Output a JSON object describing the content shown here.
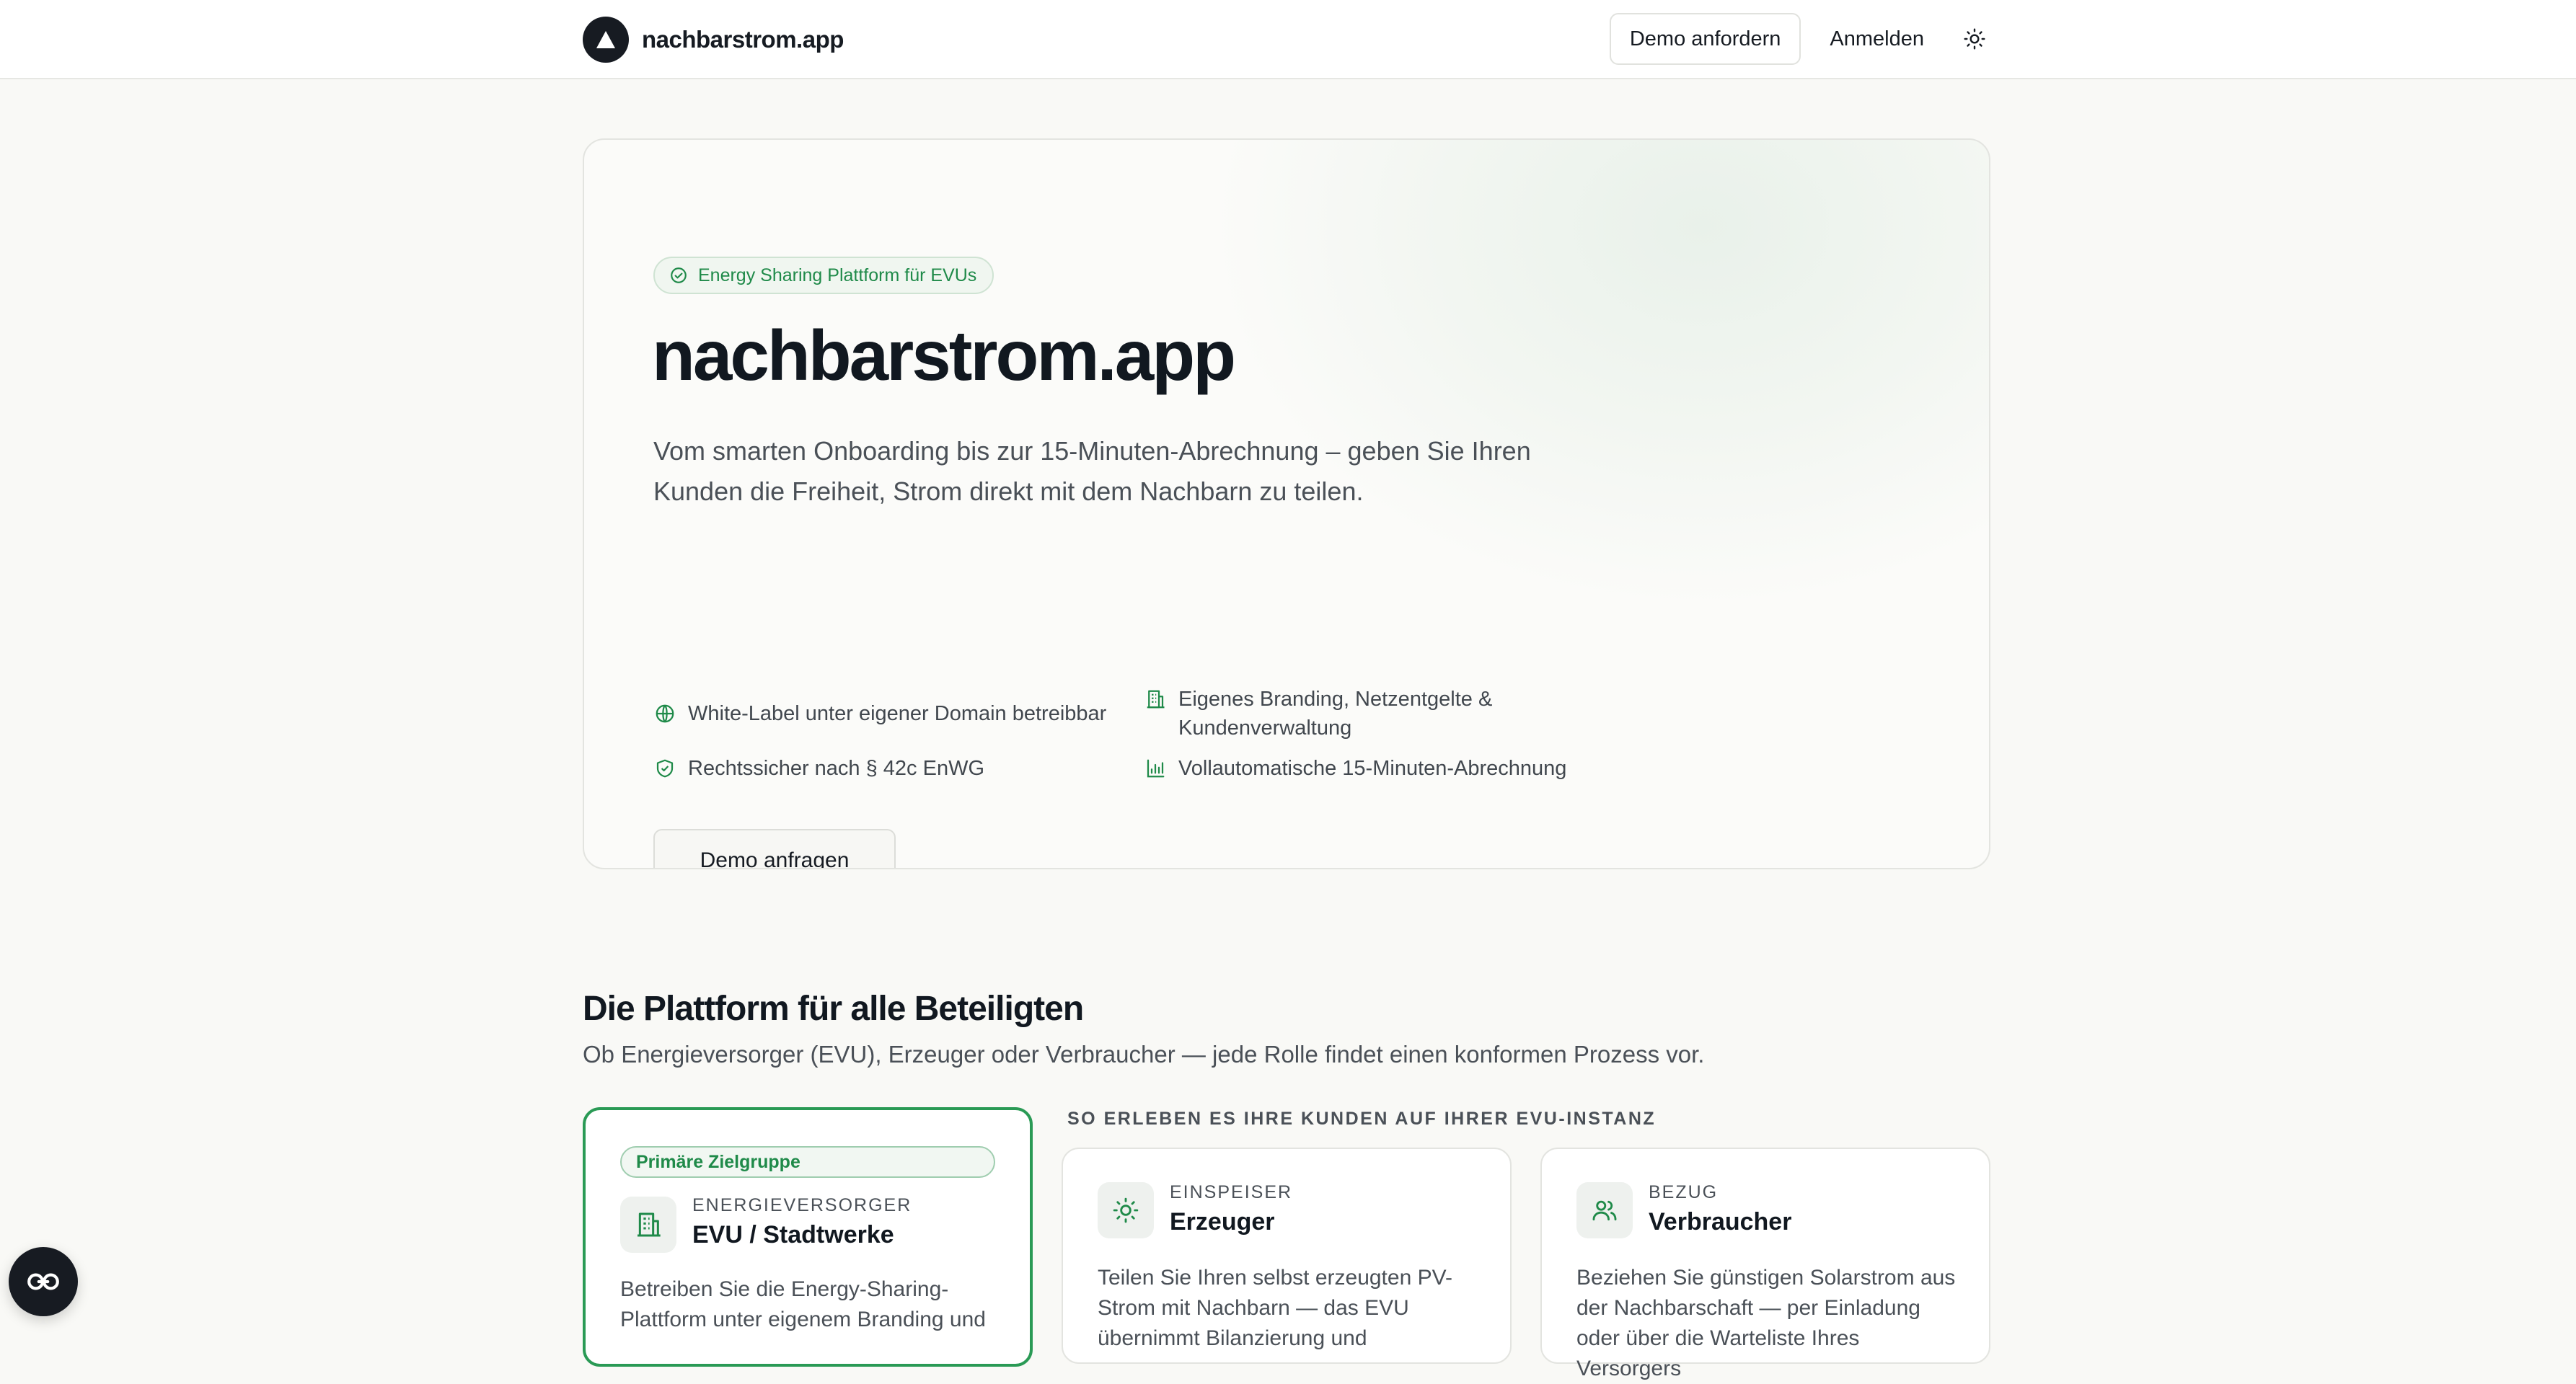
{
  "header": {
    "brand_name": "nachbarstrom.app",
    "demo_button": "Demo anfordern",
    "login_link": "Anmelden",
    "logo_icon": "triangle-logo-icon",
    "theme_icon": "sun-icon"
  },
  "hero": {
    "badge": "Energy Sharing Plattform für EVUs",
    "title": "nachbarstrom.app",
    "subtitle": "Vom smarten Onboarding bis zur 15-Minuten-Abrechnung – geben Sie Ihren Kunden die Freiheit, Strom direkt mit dem Nachbarn zu teilen.",
    "features": [
      {
        "icon": "globe-icon",
        "text": "White-Label unter eigener Domain betreibbar"
      },
      {
        "icon": "building-icon",
        "text": "Eigenes Branding, Netzentgelte & Kundenverwaltung"
      },
      {
        "icon": "shield-check-icon",
        "text": "Rechtssicher nach § 42c EnWG"
      },
      {
        "icon": "bar-chart-icon",
        "text": "Vollautomatische 15-Minuten-Abrechnung"
      }
    ],
    "cta": "Demo anfragen"
  },
  "section": {
    "title": "Die Plattform für alle Beteiligten",
    "subtitle": "Ob Energieversorger (EVU), Erzeuger oder Verbraucher — jede Rolle findet einen konformen Prozess vor.",
    "caption": "SO ERLEBEN ES IHRE KUNDEN AUF IHRER EVU-INSTANZ",
    "cards": [
      {
        "pill": "Primäre Zielgruppe",
        "eyebrow": "ENERGIEVERSORGER",
        "name": "EVU / Stadtwerke",
        "desc": "Betreiben Sie die Energy-Sharing-Plattform unter eigenem Branding und",
        "icon": "building-icon"
      },
      {
        "eyebrow": "EINSPEISER",
        "name": "Erzeuger",
        "desc": "Teilen Sie Ihren selbst erzeugten PV-Strom mit Nachbarn — das EVU übernimmt Bilanzierung und",
        "icon": "sun-icon"
      },
      {
        "eyebrow": "BEZUG",
        "name": "Verbraucher",
        "desc": "Beziehen Sie günstigen Solarstrom aus der Nachbarschaft — per Einladung oder über die Warteliste Ihres Versorgers",
        "icon": "users-icon"
      }
    ]
  },
  "widget": {
    "icon": "link-icon"
  },
  "colors": {
    "accent": "#2a9a55",
    "dark": "#171b22",
    "background": "#f9f9f6"
  }
}
